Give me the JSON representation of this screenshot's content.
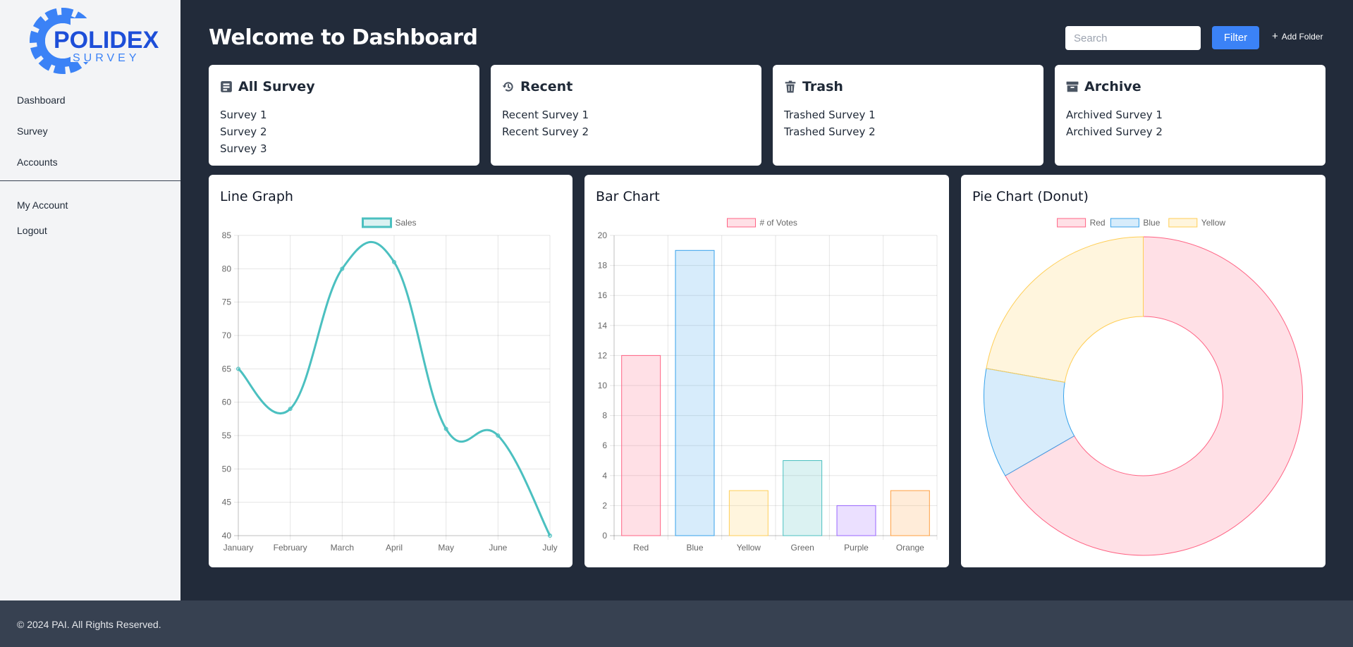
{
  "app": {
    "brand_name": "POLIDEX",
    "brand_sub": "SURVEY",
    "brand_color": "#1d4ed8"
  },
  "sidebar": {
    "items": [
      {
        "label": "Dashboard"
      },
      {
        "label": "Survey"
      },
      {
        "label": "Accounts"
      }
    ],
    "account_items": [
      {
        "label": "My Account"
      },
      {
        "label": "Logout"
      }
    ]
  },
  "header": {
    "title": "Welcome to Dashboard",
    "search_placeholder": "Search",
    "filter_label": "Filter",
    "add_folder_label": "Add Folder",
    "add_folder_icon": "plus-icon",
    "accent_color": "#3b82f6"
  },
  "folders": [
    {
      "title": "All Survey",
      "icon": "form-icon",
      "items": [
        "Survey 1",
        "Survey 2",
        "Survey 3"
      ]
    },
    {
      "title": "Recent",
      "icon": "history-icon",
      "items": [
        "Recent Survey 1",
        "Recent Survey 2"
      ]
    },
    {
      "title": "Trash",
      "icon": "trash-icon",
      "items": [
        "Trashed Survey 1",
        "Trashed Survey 2"
      ]
    },
    {
      "title": "Archive",
      "icon": "archive-icon",
      "items": [
        "Archived Survey 1",
        "Archived Survey 2"
      ]
    }
  ],
  "charts": {
    "line_title": "Line Graph",
    "bar_title": "Bar Chart",
    "pie_title": "Pie Chart (Donut)"
  },
  "chart_data": [
    {
      "type": "line",
      "title": "",
      "categories": [
        "January",
        "February",
        "March",
        "April",
        "May",
        "June",
        "July"
      ],
      "series": [
        {
          "name": "Sales",
          "values": [
            65,
            59,
            80,
            81,
            56,
            55,
            40
          ],
          "color": "#4bc0c0"
        }
      ],
      "ylim": [
        40,
        85
      ],
      "yticks": [
        40,
        45,
        50,
        55,
        60,
        65,
        70,
        75,
        80,
        85
      ],
      "grid": true,
      "legend": "top"
    },
    {
      "type": "bar",
      "title": "",
      "categories": [
        "Red",
        "Blue",
        "Yellow",
        "Green",
        "Purple",
        "Orange"
      ],
      "series": [
        {
          "name": "# of Votes",
          "values": [
            12,
            19,
            3,
            5,
            2,
            3
          ]
        }
      ],
      "colors": [
        "#ff6384",
        "#36a2eb",
        "#ffce56",
        "#4bc0c0",
        "#9966ff",
        "#ff9f40"
      ],
      "ylim": [
        0,
        20
      ],
      "yticks": [
        0,
        2,
        4,
        6,
        8,
        10,
        12,
        14,
        16,
        18,
        20
      ],
      "grid": true,
      "legend": "top"
    },
    {
      "type": "pie",
      "title": "",
      "labels": [
        "Red",
        "Blue",
        "Yellow"
      ],
      "values": [
        300,
        50,
        100
      ],
      "colors": [
        "#ff6384",
        "#36a2eb",
        "#ffce56"
      ],
      "legend": "top"
    }
  ],
  "footer": {
    "text": "© 2024 PAI. All Rights Reserved."
  }
}
